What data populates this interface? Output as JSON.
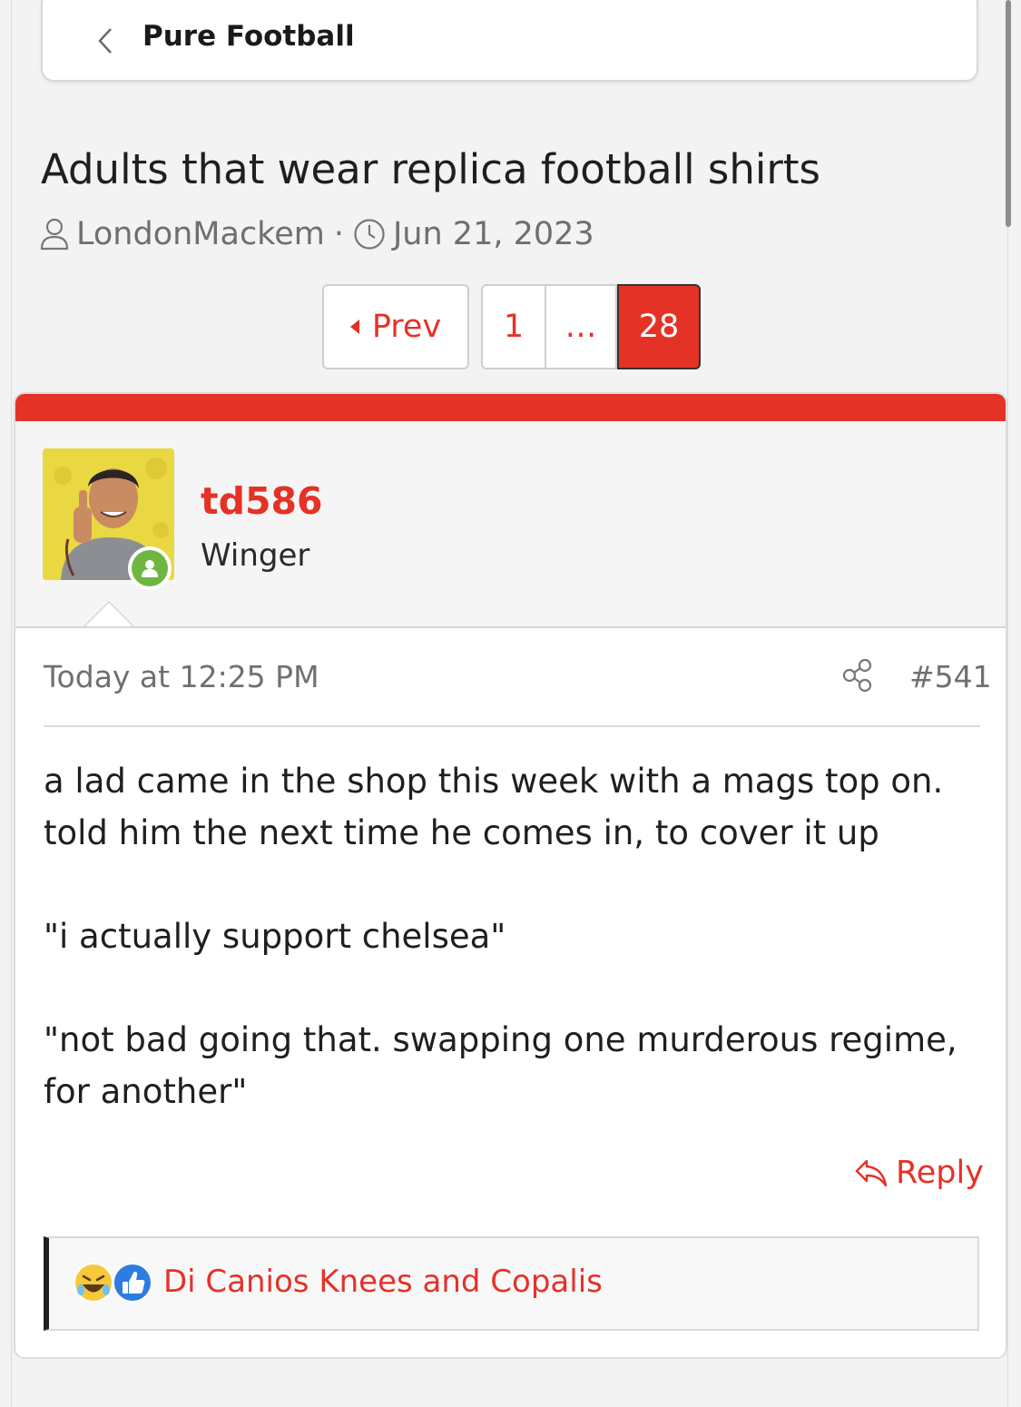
{
  "breadcrumb": {
    "label": "Pure Football"
  },
  "thread": {
    "title": "Adults that wear replica football shirts",
    "author": "LondonMackem",
    "separator": "·",
    "date": "Jun 21, 2023"
  },
  "pagination": {
    "prev_label": "Prev",
    "pages": [
      "1",
      "…",
      "28"
    ],
    "current_page": "28"
  },
  "post": {
    "username": "td586",
    "user_title": "Winger",
    "user_status": "online",
    "timestamp": "Today at 12:25 PM",
    "post_number": "#541",
    "body": [
      "a lad came in the shop this week with a mags top on. told him the next time he comes in, to cover it up",
      "\"i actually support chelsea\"",
      "\"not bad going that. swapping one murderous regime, for another\""
    ],
    "reply_label": "Reply",
    "reactions": {
      "icons": [
        "laughing-emoji-icon",
        "like-thumb-icon"
      ],
      "names": "Di Canios Knees and Copalis"
    }
  },
  "colors": {
    "accent": "#e53227",
    "online": "#6fb641",
    "like": "#2d7de0"
  }
}
